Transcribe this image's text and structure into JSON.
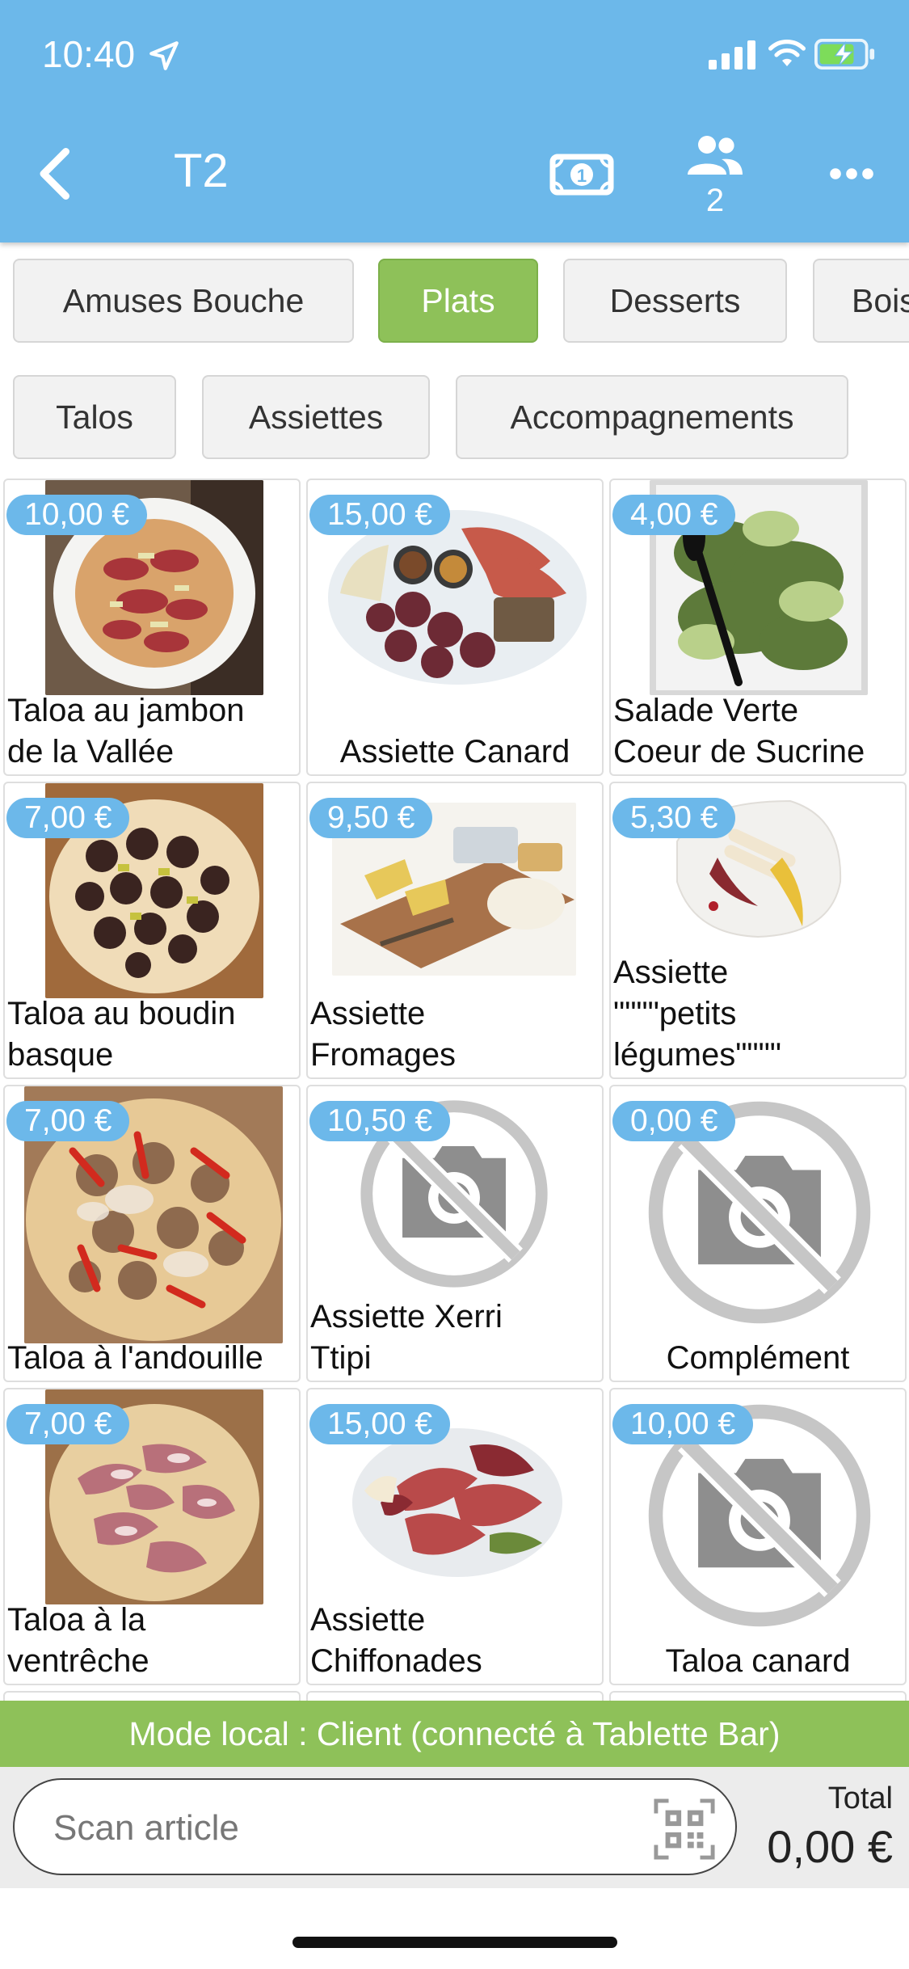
{
  "status_bar": {
    "time": "10:40"
  },
  "header": {
    "title": "T2",
    "guests_count": "2"
  },
  "categories": [
    {
      "label": "Amuses Bouche"
    },
    {
      "label": "Plats"
    },
    {
      "label": "Desserts"
    },
    {
      "label": "Bois"
    }
  ],
  "subcategories": [
    {
      "label": "Talos"
    },
    {
      "label": "Assiettes"
    },
    {
      "label": "Accompagnements"
    }
  ],
  "products": [
    {
      "price": "10,00 €",
      "name": "Taloa au jambon\nde la Vallée",
      "image": "pizza-ham"
    },
    {
      "price": "15,00 €",
      "name": "Assiette Canard",
      "image": "duck-plate"
    },
    {
      "price": "4,00 €",
      "name": "Salade Verte\nCoeur de Sucrine",
      "image": "salad"
    },
    {
      "price": "7,00 €",
      "name": "Taloa au boudin\nbasque",
      "image": "pizza-boudin"
    },
    {
      "price": "9,50 €",
      "name": "Assiette\nFromages",
      "image": "cheese-board"
    },
    {
      "price": "5,30 €",
      "name": "Assiette\n\"\"\"\"petits\nlégumes\"\"\"\"",
      "image": "vegetables"
    },
    {
      "price": "7,00 €",
      "name": "Taloa à l'andouille",
      "image": "pizza-andouille"
    },
    {
      "price": "10,50 €",
      "name": "Assiette Xerri\nTtipi",
      "image": "no-photo"
    },
    {
      "price": "0,00 €",
      "name": "Complément",
      "image": "no-photo"
    },
    {
      "price": "7,00 €",
      "name": "Taloa à la\nventrêche",
      "image": "pizza-ventreche"
    },
    {
      "price": "15,00 €",
      "name": "Assiette\nChiffonades",
      "image": "charcuterie"
    },
    {
      "price": "10,00 €",
      "name": "Taloa canard",
      "image": "no-photo"
    }
  ],
  "footer": {
    "mode_banner": "Mode local : Client (connecté à Tablette Bar)",
    "scan_placeholder": "Scan article",
    "total_label": "Total",
    "total_value": "0,00 €"
  },
  "colors": {
    "header": "#6cb8ea",
    "accent_green": "#8ec159",
    "price_badge": "#6cb8ea"
  }
}
